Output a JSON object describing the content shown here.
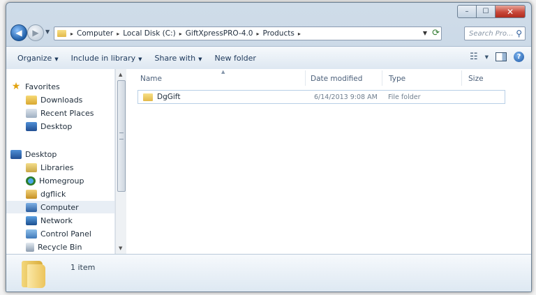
{
  "window": {
    "caption": {
      "minimize": "–",
      "maximize": "☐",
      "close": "✕"
    }
  },
  "address": {
    "breadcrumbs": [
      "Computer",
      "Local Disk (C:)",
      "GiftXpressPRO-4.0",
      "Products"
    ],
    "separator": "▸"
  },
  "search": {
    "placeholder": "Search Pro..."
  },
  "toolbar": {
    "organize": "Organize",
    "include_in_library": "Include in library",
    "share_with": "Share with",
    "new_folder": "New folder",
    "dropdown_arrow": "▼"
  },
  "nav": {
    "favorites_label": "Favorites",
    "favorites": [
      "Downloads",
      "Recent Places",
      "Desktop"
    ],
    "desktop_label": "Desktop",
    "desktop_items": [
      "Libraries",
      "Homegroup",
      "dgflick",
      "Computer",
      "Network",
      "Control Panel",
      "Recycle Bin"
    ],
    "selected": "Computer"
  },
  "columns": {
    "name": "Name",
    "date_modified": "Date modified",
    "type": "Type",
    "size": "Size"
  },
  "files": [
    {
      "name": "DgGift",
      "date_modified": "6/14/2013 9:08 AM",
      "type": "File folder",
      "size": ""
    }
  ],
  "details": {
    "item_count": "1 item"
  }
}
